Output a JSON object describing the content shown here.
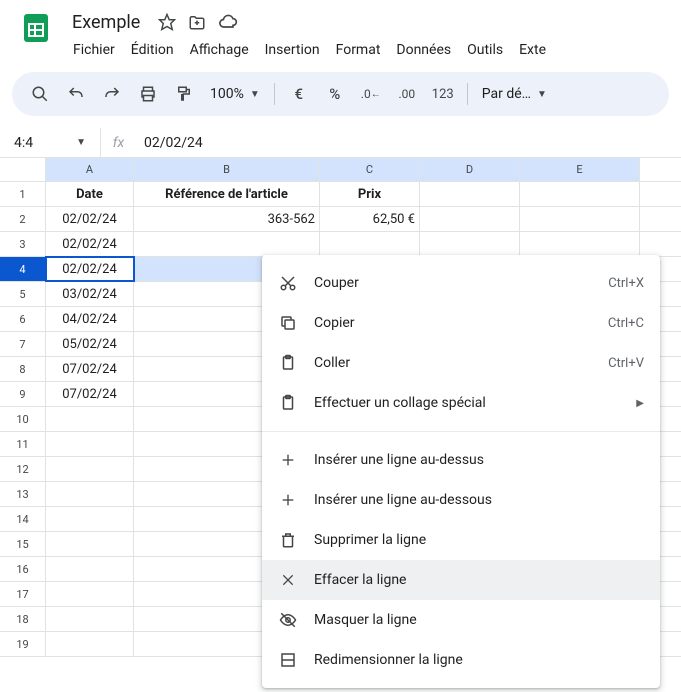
{
  "header": {
    "title": "Exemple",
    "menus": [
      "Fichier",
      "Édition",
      "Affichage",
      "Insertion",
      "Format",
      "Données",
      "Outils",
      "Exte"
    ]
  },
  "toolbar": {
    "zoom": "100%",
    "format_dropdown": "Par dé…"
  },
  "fx": {
    "name_box": "4:4",
    "value": "02/02/24"
  },
  "columns": [
    "A",
    "B",
    "C",
    "D",
    "E"
  ],
  "sheet": {
    "headers": {
      "A": "Date",
      "B": "Référence de l'article",
      "C": "Prix"
    },
    "rows": [
      {
        "n": 1,
        "A": "Date",
        "B": "Référence de l'article",
        "C": "Prix",
        "bold": true
      },
      {
        "n": 2,
        "A": "02/02/24",
        "B": "363-562",
        "C": "62,50 €"
      },
      {
        "n": 3,
        "A": "02/02/24"
      },
      {
        "n": 4,
        "A": "02/02/24",
        "selected": true
      },
      {
        "n": 5,
        "A": "03/02/24"
      },
      {
        "n": 6,
        "A": "04/02/24"
      },
      {
        "n": 7,
        "A": "05/02/24"
      },
      {
        "n": 8,
        "A": "07/02/24"
      },
      {
        "n": 9,
        "A": "07/02/24"
      },
      {
        "n": 10
      },
      {
        "n": 11
      },
      {
        "n": 12
      },
      {
        "n": 13
      },
      {
        "n": 14
      },
      {
        "n": 15
      },
      {
        "n": 16
      },
      {
        "n": 17
      },
      {
        "n": 18
      },
      {
        "n": 19
      }
    ]
  },
  "context_menu": {
    "cut": {
      "label": "Couper",
      "shortcut": "Ctrl+X"
    },
    "copy": {
      "label": "Copier",
      "shortcut": "Ctrl+C"
    },
    "paste": {
      "label": "Coller",
      "shortcut": "Ctrl+V"
    },
    "paste_special": {
      "label": "Effectuer un collage spécial"
    },
    "insert_above": {
      "label": "Insérer une ligne au-dessus"
    },
    "insert_below": {
      "label": "Insérer une ligne au-dessous"
    },
    "delete_row": {
      "label": "Supprimer la ligne"
    },
    "clear_row": {
      "label": "Effacer la ligne"
    },
    "hide_row": {
      "label": "Masquer la ligne"
    },
    "resize_row": {
      "label": "Redimensionner la ligne"
    }
  }
}
